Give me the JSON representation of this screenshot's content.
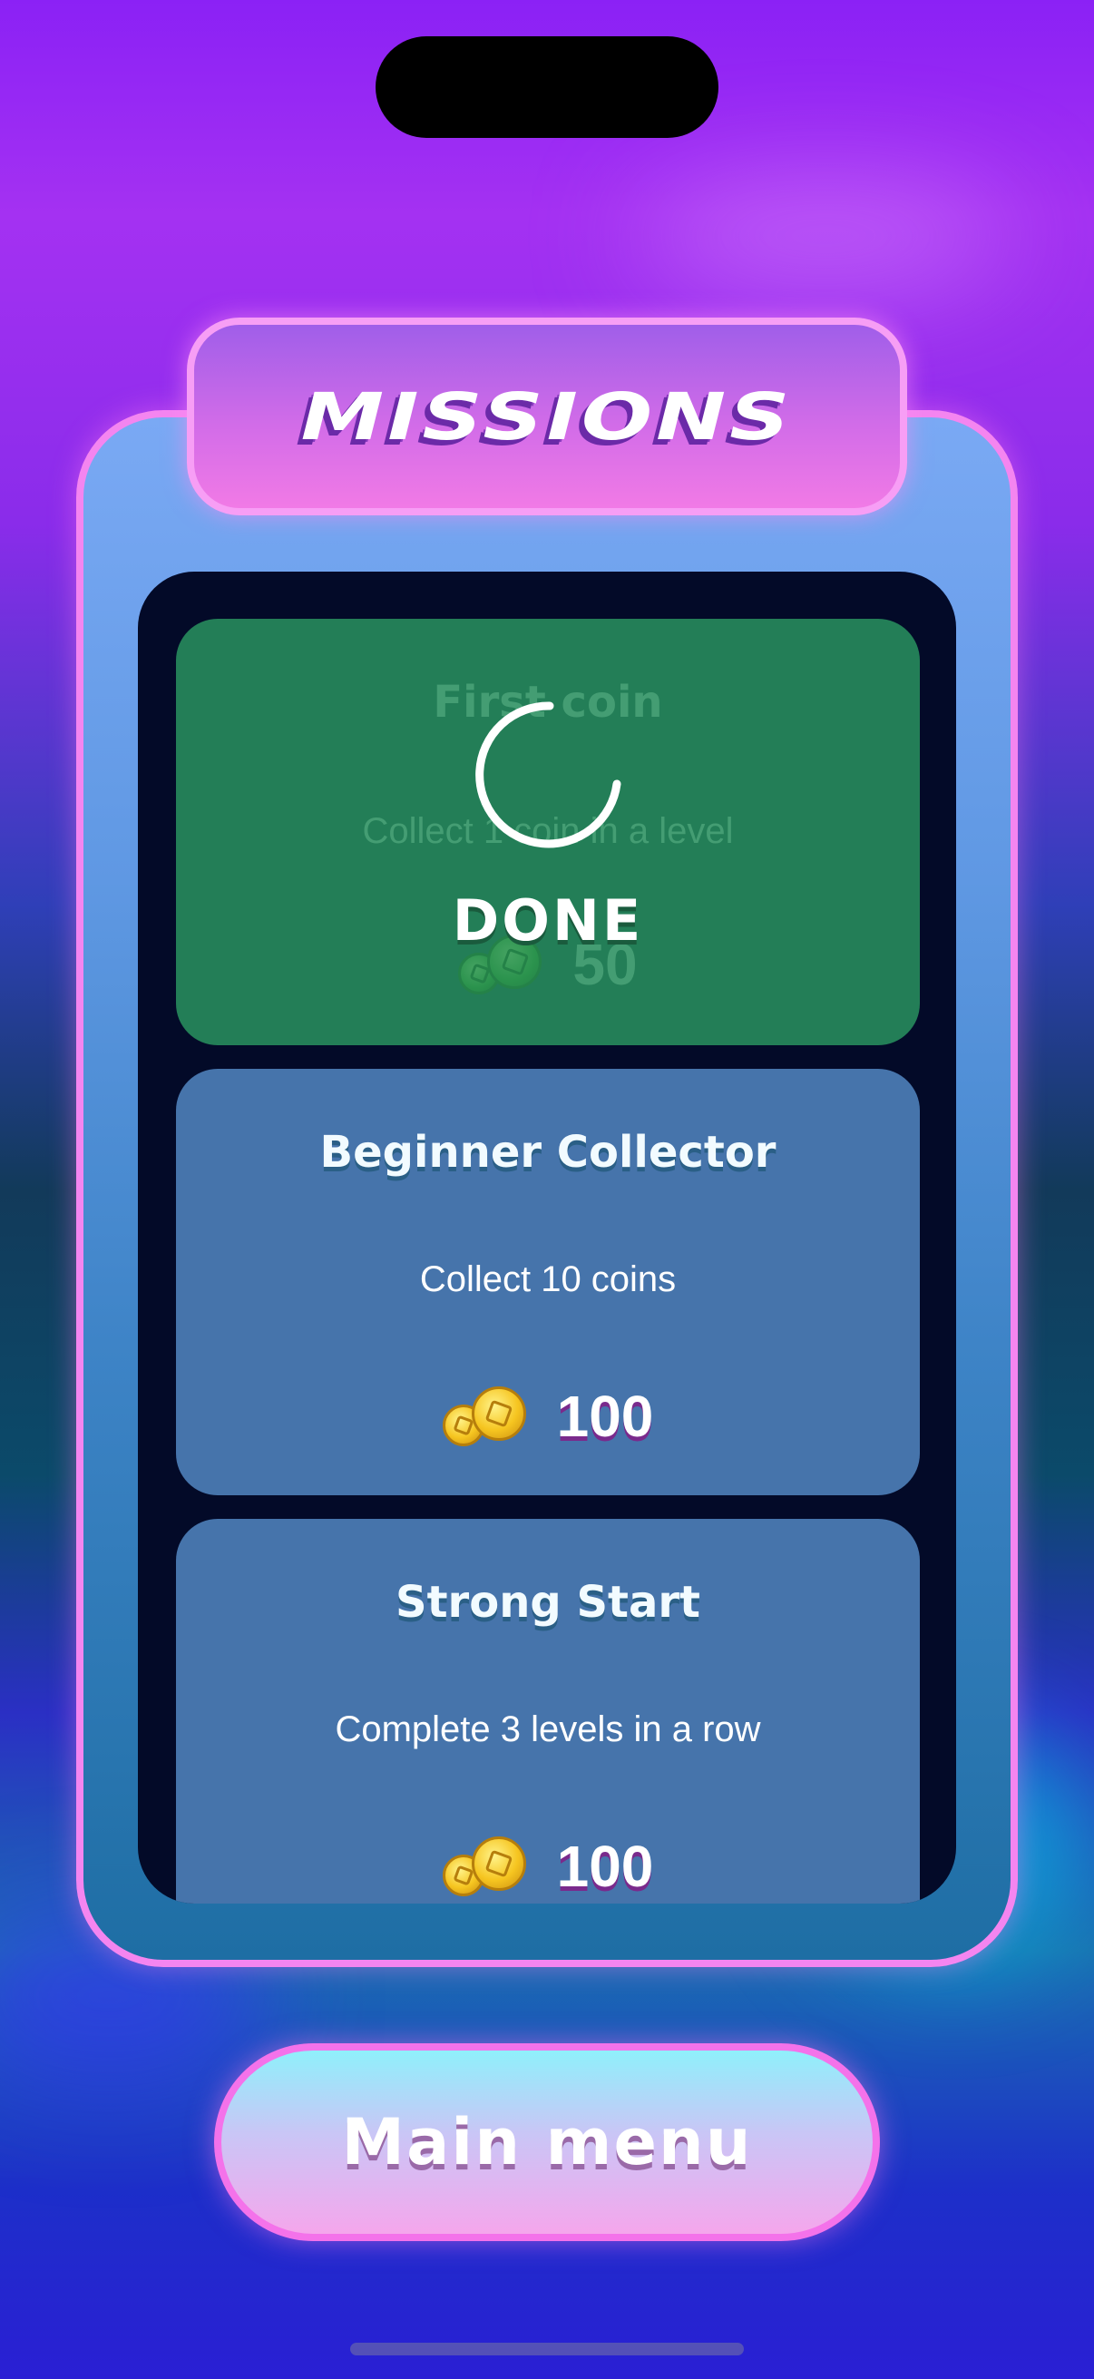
{
  "title": "MISSIONS",
  "missions": [
    {
      "title": "First coin",
      "description": "Collect 1 coin in a level",
      "reward": "50",
      "status": "DONE"
    },
    {
      "title": "Beginner Collector",
      "description": "Collect 10 coins",
      "reward": "100"
    },
    {
      "title": "Strong Start",
      "description": "Complete 3 levels in a row",
      "reward": "100"
    }
  ],
  "main_menu_label": "Main menu",
  "colors": {
    "panel_border": "#f485f0",
    "done_card": "#237e57",
    "mission_card": "#4674ab",
    "list_background": "#030a28"
  },
  "icons": {
    "reward": "coins-icon",
    "loading": "spinner-icon"
  }
}
